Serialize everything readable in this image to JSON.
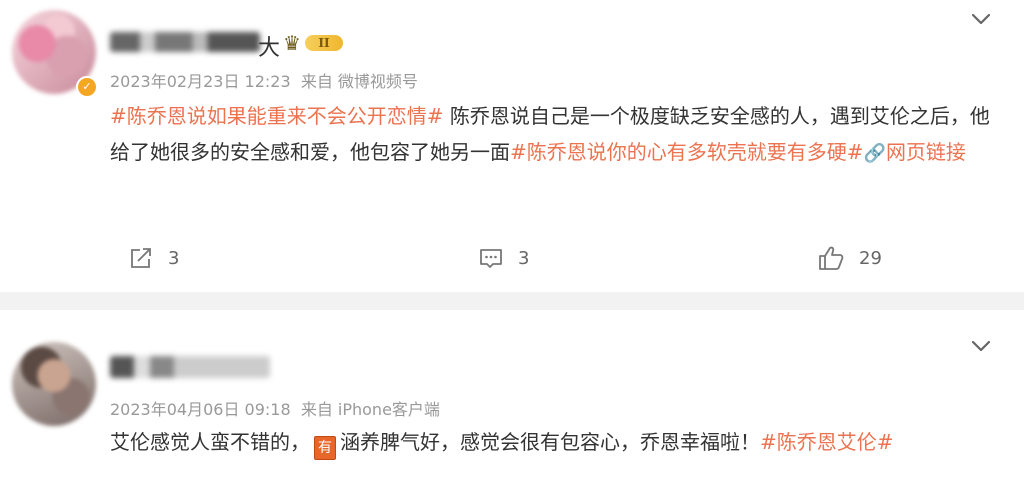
{
  "post1": {
    "author_suffix": "大",
    "vip_level": "II",
    "timestamp": "2023年02月23日 12:23",
    "source": "来自 微博视频号",
    "content": {
      "tag1": "#陈乔恩说如果能重来不会公开恋情#",
      "text1": " 陈乔恩说自己是一个极度缺乏安全感的人，遇到艾伦之后，他给了她很多的安全感和爱，他包容了她另一面",
      "tag2": "#陈乔恩说你的心有多软壳就要有多硬#",
      "link_text": "网页链接"
    },
    "actions": {
      "share_count": "3",
      "comment_count": "3",
      "like_count": "29"
    }
  },
  "post2": {
    "timestamp": "2023年04月06日 09:18",
    "source": "来自 iPhone客户端",
    "content": {
      "text1": "艾伦感觉人蛮不错的，",
      "icon_char": "有",
      "text2": "涵养脾气好，感觉会很有包容心，乔恩幸福啦！",
      "tag1": "#陈乔恩艾伦#"
    }
  },
  "icons": {
    "chevron": "chevron-down-icon",
    "share": "share-icon",
    "comment": "comment-icon",
    "like": "thumbs-up-icon",
    "link": "link-icon",
    "crown": "crown-icon"
  },
  "colors": {
    "accent": "#eb7350",
    "meta_text": "#999999",
    "separator": "#f2f2f2"
  }
}
